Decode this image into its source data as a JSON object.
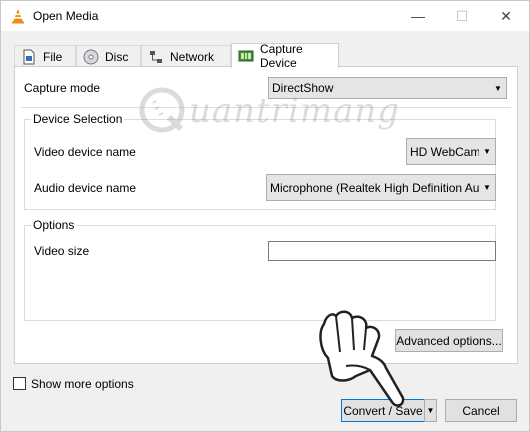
{
  "window": {
    "title": "Open Media"
  },
  "tabs": [
    {
      "label": "File",
      "icon": "file-icon"
    },
    {
      "label": "Disc",
      "icon": "disc-icon"
    },
    {
      "label": "Network",
      "icon": "network-icon"
    },
    {
      "label": "Capture Device",
      "icon": "capture-device-icon",
      "active": true
    }
  ],
  "capture": {
    "mode_label": "Capture mode",
    "mode_value": "DirectShow",
    "device_selection_title": "Device Selection",
    "video_device_label": "Video device name",
    "video_device_value": "HD WebCam",
    "audio_device_label": "Audio device name",
    "audio_device_value": "Microphone (Realtek High Definition Audio)",
    "options_title": "Options",
    "video_size_label": "Video size",
    "video_size_value": ""
  },
  "buttons": {
    "advanced": "Advanced options...",
    "convert_save": "Convert / Save",
    "cancel": "Cancel"
  },
  "show_more": {
    "label": "Show more options",
    "checked": false
  },
  "watermark": {
    "text": "uantrimang"
  },
  "colors": {
    "accent_border": "#0078d7",
    "vlc_orange": "#f08a1c"
  }
}
